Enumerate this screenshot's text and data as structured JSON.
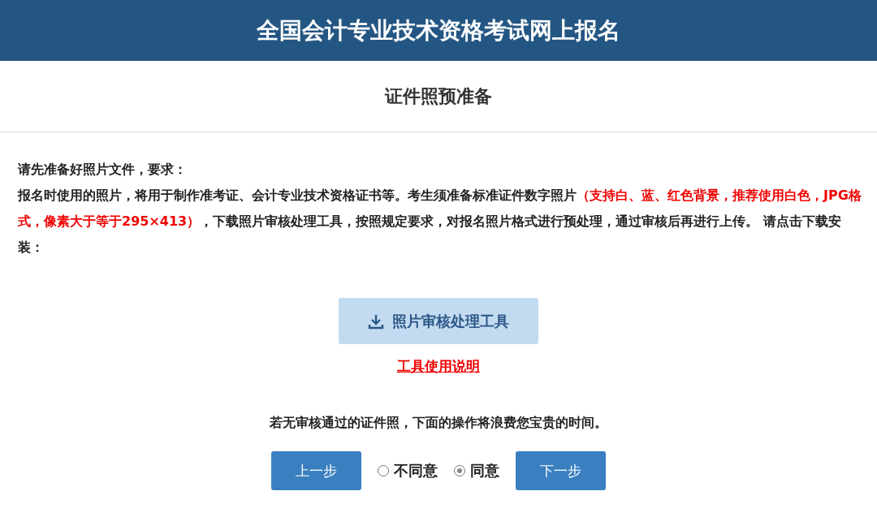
{
  "header": {
    "title": "全国会计专业技术资格考试网上报名"
  },
  "section": {
    "title": "证件照预准备"
  },
  "intro": "请先准备好照片文件，要求：",
  "paragraph": [
    {
      "text": "报名时使用的照片，将用于制作准考证、会计专业技术资格证书等。考生须准备标准证件数字照片",
      "highlight": false
    },
    {
      "text": "（支持白、蓝、红色背景，推荐使用白色，JPG格式，像素大于等于295×413）",
      "highlight": true
    },
    {
      "text": "，下载照片审核处理工具，按照规定要求，对报名照片格式进行预处理，通过审核后再进行上传。 请点击下载安装：",
      "highlight": false
    }
  ],
  "download_button": {
    "label": "照片审核处理工具"
  },
  "help_link": "工具使用说明",
  "notice": "若无审核通过的证件照，下面的操作将浪费您宝贵的时间。",
  "prev_button": "上一步",
  "options": [
    {
      "label": "不同意",
      "selected": false
    },
    {
      "label": "同意",
      "selected": true
    }
  ],
  "next_button": "下一步"
}
